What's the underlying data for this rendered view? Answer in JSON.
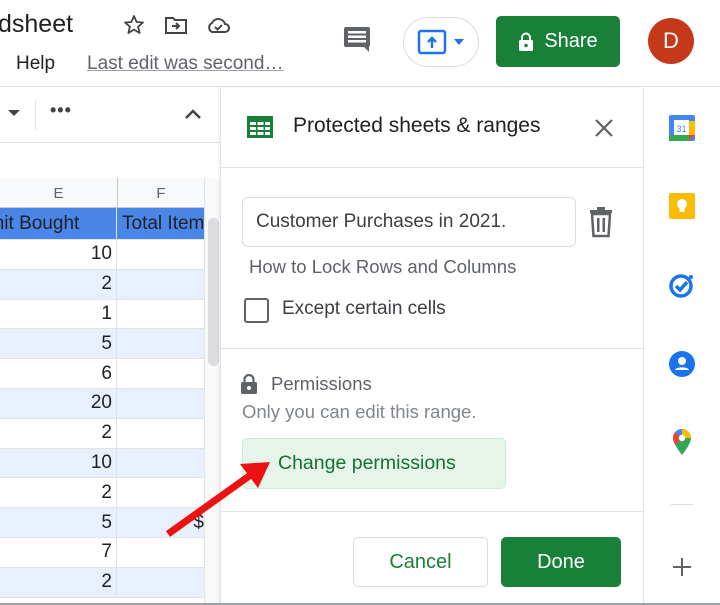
{
  "header": {
    "doc_title_fragment": "dsheet",
    "menu_help": "Help",
    "last_edit": "Last edit was second…",
    "share_label": "Share",
    "avatar_initial": "D",
    "icons": [
      "star-icon",
      "move-to-folder-icon",
      "cloud-saved-icon",
      "comments-icon",
      "present-icon",
      "lock-icon"
    ]
  },
  "toolbar": {
    "more_label": "•••"
  },
  "sheet": {
    "columns": [
      "E",
      "F"
    ],
    "header_row": {
      "e": "Unit Bought",
      "f": "Total Item"
    },
    "rows": [
      {
        "e": "10",
        "f": ""
      },
      {
        "e": "2",
        "f": ""
      },
      {
        "e": "1",
        "f": ""
      },
      {
        "e": "5",
        "f": ""
      },
      {
        "e": "6",
        "f": ""
      },
      {
        "e": "20",
        "f": ""
      },
      {
        "e": "2",
        "f": ""
      },
      {
        "e": "10",
        "f": ""
      },
      {
        "e": "2",
        "f": ""
      },
      {
        "e": "5",
        "f": "$"
      },
      {
        "e": "7",
        "f": ""
      },
      {
        "e": "2",
        "f": ""
      }
    ]
  },
  "panel": {
    "title": "Protected sheets & ranges",
    "description_value": "Customer Purchases in 2021.",
    "range_label": "How to Lock Rows and Columns",
    "except_cells_label": "Except certain cells",
    "except_cells_checked": false,
    "permissions_title": "Permissions",
    "permissions_desc": "Only you can edit this range.",
    "change_permissions_label": "Change permissions",
    "cancel_label": "Cancel",
    "done_label": "Done"
  },
  "rail": {
    "calendar_day": "31",
    "apps": [
      "calendar",
      "keep",
      "tasks",
      "contacts",
      "maps"
    ]
  },
  "colors": {
    "accent_green": "#188038",
    "header_row_blue": "#4a86e8",
    "alt_row_blue": "#e8f0fe",
    "avatar": "#c5391a",
    "annotation_arrow": "#ee1111"
  }
}
